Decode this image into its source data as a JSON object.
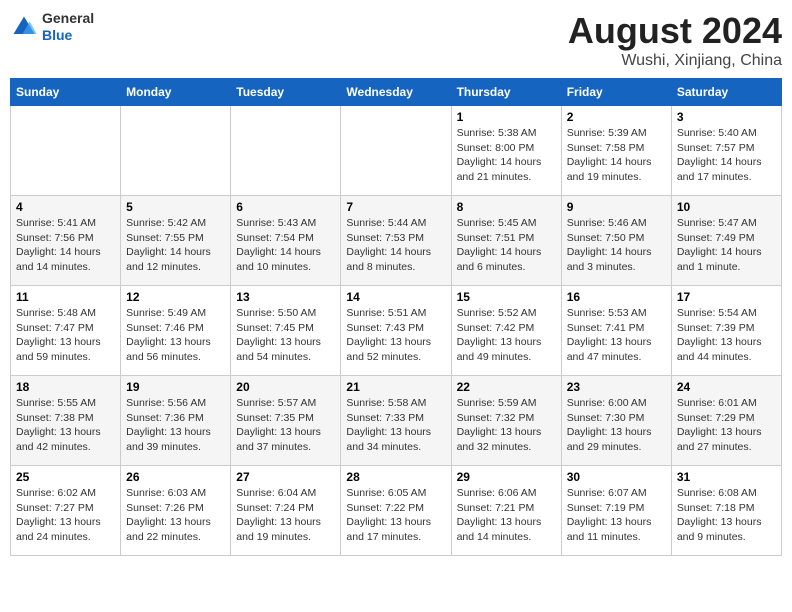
{
  "header": {
    "logo_general": "General",
    "logo_blue": "Blue",
    "title": "August 2024",
    "subtitle": "Wushi, Xinjiang, China"
  },
  "days_of_week": [
    "Sunday",
    "Monday",
    "Tuesday",
    "Wednesday",
    "Thursday",
    "Friday",
    "Saturday"
  ],
  "weeks": [
    [
      {
        "day": "",
        "info": ""
      },
      {
        "day": "",
        "info": ""
      },
      {
        "day": "",
        "info": ""
      },
      {
        "day": "",
        "info": ""
      },
      {
        "day": "1",
        "info": "Sunrise: 5:38 AM\nSunset: 8:00 PM\nDaylight: 14 hours\nand 21 minutes."
      },
      {
        "day": "2",
        "info": "Sunrise: 5:39 AM\nSunset: 7:58 PM\nDaylight: 14 hours\nand 19 minutes."
      },
      {
        "day": "3",
        "info": "Sunrise: 5:40 AM\nSunset: 7:57 PM\nDaylight: 14 hours\nand 17 minutes."
      }
    ],
    [
      {
        "day": "4",
        "info": "Sunrise: 5:41 AM\nSunset: 7:56 PM\nDaylight: 14 hours\nand 14 minutes."
      },
      {
        "day": "5",
        "info": "Sunrise: 5:42 AM\nSunset: 7:55 PM\nDaylight: 14 hours\nand 12 minutes."
      },
      {
        "day": "6",
        "info": "Sunrise: 5:43 AM\nSunset: 7:54 PM\nDaylight: 14 hours\nand 10 minutes."
      },
      {
        "day": "7",
        "info": "Sunrise: 5:44 AM\nSunset: 7:53 PM\nDaylight: 14 hours\nand 8 minutes."
      },
      {
        "day": "8",
        "info": "Sunrise: 5:45 AM\nSunset: 7:51 PM\nDaylight: 14 hours\nand 6 minutes."
      },
      {
        "day": "9",
        "info": "Sunrise: 5:46 AM\nSunset: 7:50 PM\nDaylight: 14 hours\nand 3 minutes."
      },
      {
        "day": "10",
        "info": "Sunrise: 5:47 AM\nSunset: 7:49 PM\nDaylight: 14 hours\nand 1 minute."
      }
    ],
    [
      {
        "day": "11",
        "info": "Sunrise: 5:48 AM\nSunset: 7:47 PM\nDaylight: 13 hours\nand 59 minutes."
      },
      {
        "day": "12",
        "info": "Sunrise: 5:49 AM\nSunset: 7:46 PM\nDaylight: 13 hours\nand 56 minutes."
      },
      {
        "day": "13",
        "info": "Sunrise: 5:50 AM\nSunset: 7:45 PM\nDaylight: 13 hours\nand 54 minutes."
      },
      {
        "day": "14",
        "info": "Sunrise: 5:51 AM\nSunset: 7:43 PM\nDaylight: 13 hours\nand 52 minutes."
      },
      {
        "day": "15",
        "info": "Sunrise: 5:52 AM\nSunset: 7:42 PM\nDaylight: 13 hours\nand 49 minutes."
      },
      {
        "day": "16",
        "info": "Sunrise: 5:53 AM\nSunset: 7:41 PM\nDaylight: 13 hours\nand 47 minutes."
      },
      {
        "day": "17",
        "info": "Sunrise: 5:54 AM\nSunset: 7:39 PM\nDaylight: 13 hours\nand 44 minutes."
      }
    ],
    [
      {
        "day": "18",
        "info": "Sunrise: 5:55 AM\nSunset: 7:38 PM\nDaylight: 13 hours\nand 42 minutes."
      },
      {
        "day": "19",
        "info": "Sunrise: 5:56 AM\nSunset: 7:36 PM\nDaylight: 13 hours\nand 39 minutes."
      },
      {
        "day": "20",
        "info": "Sunrise: 5:57 AM\nSunset: 7:35 PM\nDaylight: 13 hours\nand 37 minutes."
      },
      {
        "day": "21",
        "info": "Sunrise: 5:58 AM\nSunset: 7:33 PM\nDaylight: 13 hours\nand 34 minutes."
      },
      {
        "day": "22",
        "info": "Sunrise: 5:59 AM\nSunset: 7:32 PM\nDaylight: 13 hours\nand 32 minutes."
      },
      {
        "day": "23",
        "info": "Sunrise: 6:00 AM\nSunset: 7:30 PM\nDaylight: 13 hours\nand 29 minutes."
      },
      {
        "day": "24",
        "info": "Sunrise: 6:01 AM\nSunset: 7:29 PM\nDaylight: 13 hours\nand 27 minutes."
      }
    ],
    [
      {
        "day": "25",
        "info": "Sunrise: 6:02 AM\nSunset: 7:27 PM\nDaylight: 13 hours\nand 24 minutes."
      },
      {
        "day": "26",
        "info": "Sunrise: 6:03 AM\nSunset: 7:26 PM\nDaylight: 13 hours\nand 22 minutes."
      },
      {
        "day": "27",
        "info": "Sunrise: 6:04 AM\nSunset: 7:24 PM\nDaylight: 13 hours\nand 19 minutes."
      },
      {
        "day": "28",
        "info": "Sunrise: 6:05 AM\nSunset: 7:22 PM\nDaylight: 13 hours\nand 17 minutes."
      },
      {
        "day": "29",
        "info": "Sunrise: 6:06 AM\nSunset: 7:21 PM\nDaylight: 13 hours\nand 14 minutes."
      },
      {
        "day": "30",
        "info": "Sunrise: 6:07 AM\nSunset: 7:19 PM\nDaylight: 13 hours\nand 11 minutes."
      },
      {
        "day": "31",
        "info": "Sunrise: 6:08 AM\nSunset: 7:18 PM\nDaylight: 13 hours\nand 9 minutes."
      }
    ]
  ]
}
